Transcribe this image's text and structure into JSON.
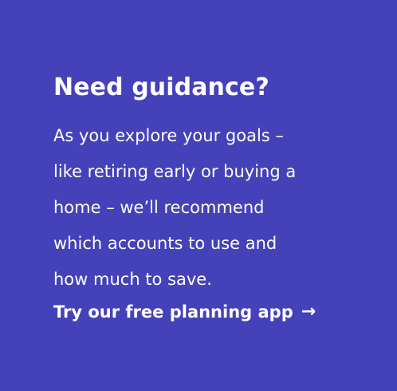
{
  "promo": {
    "heading": "Need guidance?",
    "body_lines": [
      "As you explore your goals –",
      "like retiring early or buying a",
      "home – we’ll recommend",
      "which accounts to use and",
      "how much to save."
    ],
    "cta_label": "Try our free planning app",
    "cta_icon": "right-arrow-icon"
  },
  "colors": {
    "background": "#4541b9",
    "text": "#ffffff"
  }
}
